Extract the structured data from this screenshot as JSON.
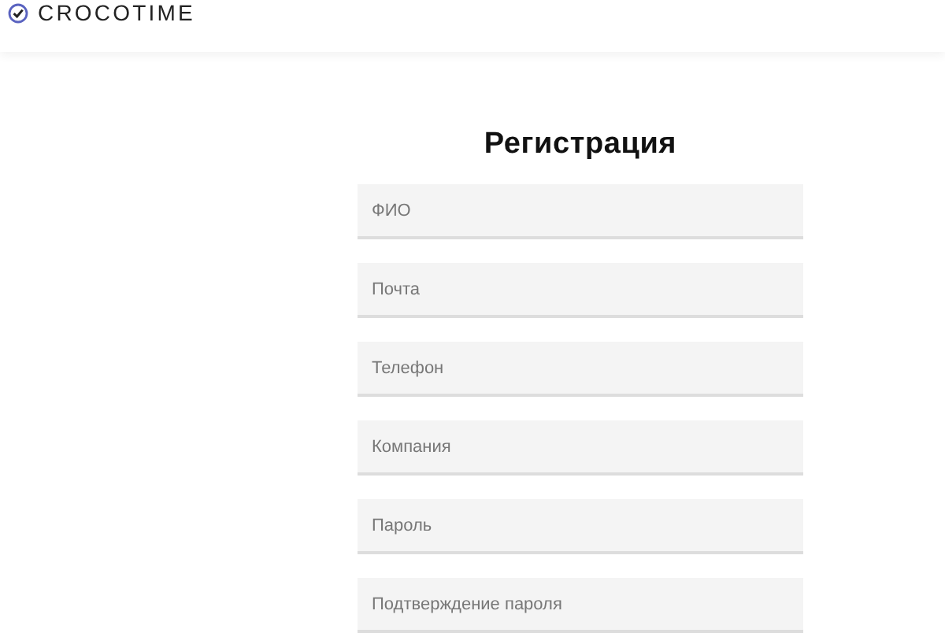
{
  "header": {
    "logo": "CROCOTIME"
  },
  "form": {
    "title": "Регистрация",
    "fields": [
      {
        "placeholder": "ФИО"
      },
      {
        "placeholder": "Почта"
      },
      {
        "placeholder": "Телефон"
      },
      {
        "placeholder": "Компания"
      },
      {
        "placeholder": "Пароль"
      },
      {
        "placeholder": "Подтверждение пароля"
      }
    ]
  }
}
